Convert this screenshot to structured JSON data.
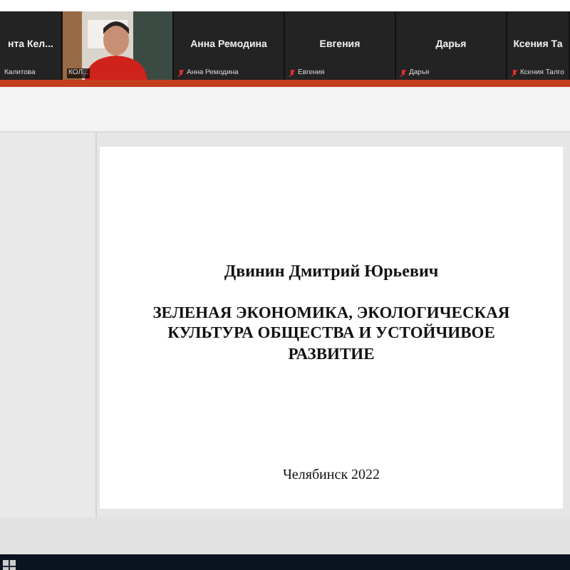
{
  "participants": [
    {
      "kind": "name",
      "name": "нта Кел...",
      "label": "Калитова"
    },
    {
      "kind": "video",
      "label": "КОЛ..."
    },
    {
      "kind": "name",
      "name": "Анна Ремодина",
      "label": "Анна Ремодина",
      "muted": true
    },
    {
      "kind": "name",
      "name": "Евгения",
      "label": "Евгения",
      "muted": true
    },
    {
      "kind": "name",
      "name": "Дарья",
      "label": "Дарья",
      "muted": true
    },
    {
      "kind": "name",
      "name": "Ксения Та",
      "label": "Ксения Талго",
      "muted": true
    }
  ],
  "slide": {
    "author": "Двинин Дмитрий Юрьевич",
    "title": "ЗЕЛЕНАЯ ЭКОНОМИКА, ЭКОЛОГИЧЕСКАЯ КУЛЬТУРА ОБЩЕСТВА И УСТОЙЧИВОЕ РАЗВИТИЕ",
    "footer": "Челябинск 2022"
  }
}
